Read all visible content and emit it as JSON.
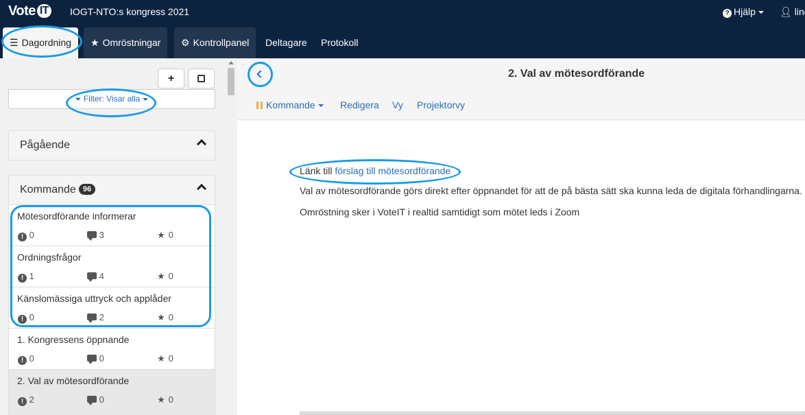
{
  "app": {
    "logo_text": "Vote",
    "logo_badge": "IT",
    "meeting_title": "IOGT-NTO:s kongress 2021"
  },
  "header": {
    "help_label": "Hjälp",
    "user_label": "lind"
  },
  "tabs": [
    {
      "label": "Dagordning",
      "icon": "list-icon"
    },
    {
      "label": "Omröstningar",
      "icon": "star-icon"
    },
    {
      "label": "Kontrollpanel",
      "icon": "gear-icon"
    },
    {
      "label": "Deltagare"
    },
    {
      "label": "Protokoll"
    }
  ],
  "sidebar": {
    "add_symbol": "+",
    "filter_label": "Filter: Visar alla",
    "sections": {
      "ongoing": {
        "label": "Pågående"
      },
      "upcoming": {
        "label": "Kommande",
        "count": "96"
      }
    },
    "items": [
      {
        "title": "Mötesordförande informerar",
        "proposals": "0",
        "discussions": "3",
        "votes": "0"
      },
      {
        "title": "Ordningsfrågor",
        "proposals": "1",
        "discussions": "4",
        "votes": "0"
      },
      {
        "title": "Känslomässiga uttryck och applåder",
        "proposals": "0",
        "discussions": "2",
        "votes": "0"
      },
      {
        "title": "1. Kongressens öppnande",
        "proposals": "0",
        "discussions": "0",
        "votes": "0"
      },
      {
        "title": "2. Val av mötesordförande",
        "proposals": "2",
        "discussions": "0",
        "votes": "0",
        "active": true
      }
    ]
  },
  "main": {
    "title": "2. Val av mötesordförande",
    "subnav": {
      "state_label": "Kommande",
      "edit_label": "Redigera",
      "view_label": "Vy",
      "projector_label": "Projektorvy"
    },
    "body": {
      "line1_prefix": "Länk till ",
      "line1_link": "förslag till mötesordförande",
      "line2": "Val av mötesordförande görs direkt efter öppnandet för att de på bästa sätt ska kunna leda de digitala förhandlingarna.",
      "line3": "Omröstning sker i VoteIT i realtid samtidigt som mötet leds i Zoom"
    }
  },
  "colors": {
    "navbar": "#0c2340",
    "link": "#2a6fb3",
    "annotation": "#1a9be6",
    "state_icon": "#f0ad4e"
  }
}
